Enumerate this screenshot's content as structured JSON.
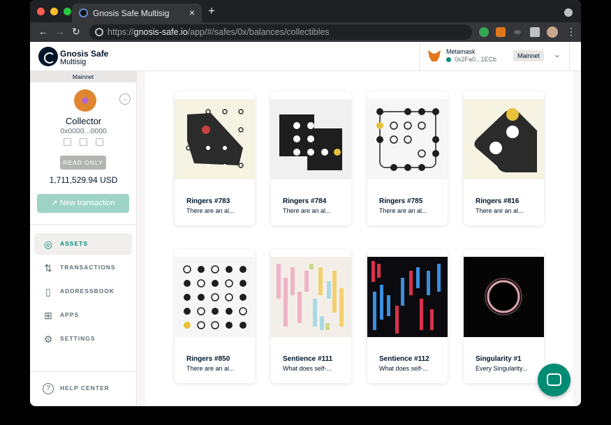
{
  "browser": {
    "tab_title": "Gnosis Safe Multisig",
    "tab_close": "×",
    "new_tab": "+",
    "url_prefix": "https://",
    "url_host": "gnosis-safe.io",
    "url_path": "/app/#/safes/0x/balances/collectibles",
    "nav_back": "←",
    "nav_forward": "→",
    "nav_reload": "↻",
    "more": "⋮"
  },
  "header": {
    "logo_line1": "Gnosis Safe",
    "logo_line2": "Multisig",
    "wallet_name": "Metamask",
    "wallet_address": "0x2Fa0...1ECb",
    "network": "Mainnet",
    "chevron": "⌄"
  },
  "sidebar": {
    "network_label": "Mainnet",
    "safe_name": "Collector",
    "safe_address": "0x0000...0000",
    "read_only": "READ ONLY",
    "balance": "1,711,529.94 USD",
    "new_transaction": "New transaction",
    "items": [
      {
        "label": "ASSETS",
        "icon": "coins-icon",
        "glyph": "◎"
      },
      {
        "label": "TRANSACTIONS",
        "icon": "transactions-icon",
        "glyph": "⇅"
      },
      {
        "label": "ADDRESSBOOK",
        "icon": "addressbook-icon",
        "glyph": "▯"
      },
      {
        "label": "APPS",
        "icon": "apps-icon",
        "glyph": "⊞"
      },
      {
        "label": "SETTINGS",
        "icon": "gear-icon",
        "glyph": "⚙"
      }
    ],
    "help_center": "HELP CENTER",
    "help_glyph": "?"
  },
  "collectibles": [
    {
      "name": "Ringers #783",
      "desc": "There are an al..."
    },
    {
      "name": "Ringers #784",
      "desc": "There are an al..."
    },
    {
      "name": "Ringers #785",
      "desc": "There are an al..."
    },
    {
      "name": "Ringers #816",
      "desc": "There are an al..."
    },
    {
      "name": "Ringers #850",
      "desc": "There are an al..."
    },
    {
      "name": "Sentience #111",
      "desc": "What does self-..."
    },
    {
      "name": "Sentience #112",
      "desc": "What does self-..."
    },
    {
      "name": "Singularity #1",
      "desc": "Every Singularity..."
    }
  ],
  "colors": {
    "accent": "#008c73",
    "dark": "#001428",
    "new_tx_button": "#9ed4c6"
  }
}
